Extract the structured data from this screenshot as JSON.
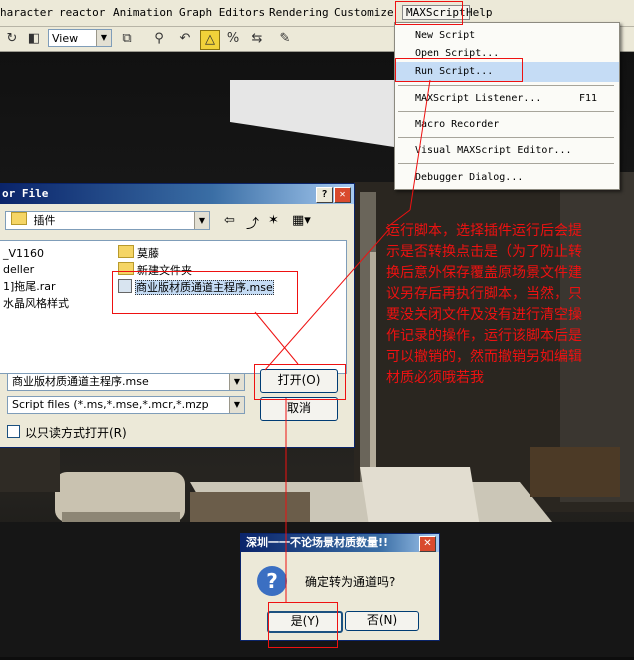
{
  "menubar": {
    "items": [
      "haracter",
      "reactor",
      "Animation",
      "Graph Editors",
      "Rendering",
      "Customize",
      "MAXScript",
      "Help"
    ]
  },
  "toolbar": {
    "view_value": "View"
  },
  "maxscript_menu": {
    "new_script": "New Script",
    "open_script": "Open Script...",
    "run_script": "Run Script...",
    "listener": "MAXScript Listener...",
    "listener_shortcut": "F11",
    "macro_recorder": "Macro Recorder",
    "visual_editor": "Visual MAXScript Editor...",
    "debugger": "Debugger Dialog..."
  },
  "file_dialog": {
    "title": "or File",
    "look_in": "插件",
    "files_left": [
      "_V1160",
      "deller",
      "1]拖尾.rar",
      "水晶风格样式"
    ],
    "folders_right": [
      "莫藤",
      "新建文件夹"
    ],
    "selected_file": "商业版材质通道主程序.mse",
    "filename_value": "商业版材质通道主程序.mse",
    "filetype_value": "Script files (*.ms,*.mse,*.mcr,*.mzp",
    "open_button": "打开(O)",
    "cancel_button": "取消",
    "readonly_checkbox": "以只读方式打开(R)"
  },
  "annotation": "运行脚本，选择插件运行后会提示是否转换点击是（为了防止转换后意外保存覆盖原场景文件建议另存后再执行脚本，当然，只要没关闭文件及没有进行清空操作记录的操作，运行该脚本后是可以撤销的，然而撤销另如编辑材质必须哦若我",
  "confirm_dialog": {
    "title": "深圳一一不论场景材质数量!!",
    "message": "确定转为通道吗?",
    "yes_button": "是(Y)",
    "no_button": "否(N)"
  },
  "colors": {
    "annotation": "#ee1111",
    "titlebar": "#0a246a",
    "highlight": "#c5dcf5"
  }
}
